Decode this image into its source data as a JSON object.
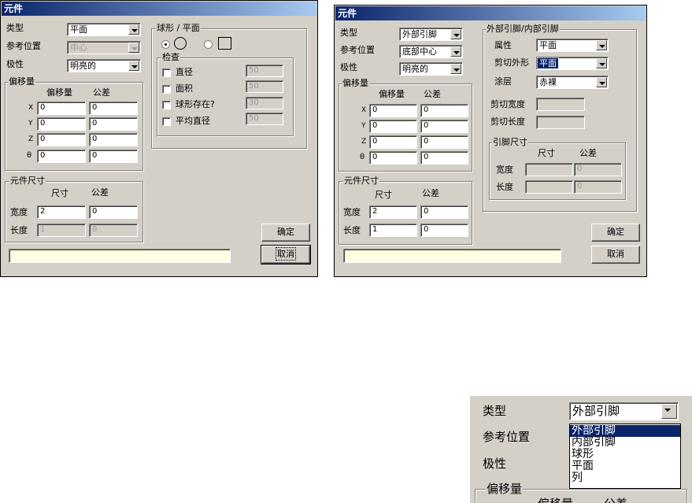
{
  "left_dialog": {
    "title": "元件",
    "type_label": "类型",
    "type_value": "平面",
    "ref_label": "参考位置",
    "ref_value": "中心",
    "polarity_label": "极性",
    "polarity_value": "明亮的",
    "offset_group": "偏移量",
    "offset_col": "偏移量",
    "tol_col": "公差",
    "rows": [
      {
        "label": "X",
        "offset": "0",
        "tol": "0"
      },
      {
        "label": "Y",
        "offset": "0",
        "tol": "0"
      },
      {
        "label": "Z",
        "offset": "0",
        "tol": "0"
      },
      {
        "label": "θ",
        "offset": "0",
        "tol": "0"
      }
    ],
    "size_group": "元件尺寸",
    "size_col": "尺寸",
    "size_tol_col": "公差",
    "width_label": "宽度",
    "width_value": "2",
    "width_tol": "0",
    "length_label": "长度",
    "length_value": "1",
    "length_tol": "0",
    "ball_group": "球形 / 平面",
    "check_group": "检查",
    "checks": [
      {
        "label": "直径",
        "value": "50"
      },
      {
        "label": "面积",
        "value": "50"
      },
      {
        "label": "球形存在?",
        "value": "30"
      },
      {
        "label": "平均直径",
        "value": "50"
      }
    ],
    "ok": "确定",
    "cancel": "取消",
    "status": ""
  },
  "right_dialog": {
    "title": "元件",
    "type_label": "类型",
    "type_value": "外部引脚",
    "ref_label": "参考位置",
    "ref_value": "底部中心",
    "polarity_label": "极性",
    "polarity_value": "明亮的",
    "offset_group": "偏移量",
    "offset_col": "偏移量",
    "tol_col": "公差",
    "rows": [
      {
        "label": "X",
        "offset": "0",
        "tol": "0"
      },
      {
        "label": "Y",
        "offset": "0",
        "tol": "0"
      },
      {
        "label": "Z",
        "offset": "0",
        "tol": "0"
      },
      {
        "label": "θ",
        "offset": "0",
        "tol": "0"
      }
    ],
    "size_group": "元件尺寸",
    "size_col": "尺寸",
    "size_tol_col": "公差",
    "width_label": "宽度",
    "width_value": "2",
    "width_tol": "0",
    "length_label": "长度",
    "length_value": "1",
    "length_tol": "0",
    "lead_group": "外部引脚/内部引脚",
    "attr_label": "属性",
    "attr_value": "平面",
    "cut_shape_label": "剪切外形",
    "cut_shape_value": "平面",
    "coating_label": "涂层",
    "coating_value": "赤裸",
    "cut_width_label": "剪切宽度",
    "cut_length_label": "剪切长度",
    "pin_group": "引脚尺寸",
    "pin_size_col": "尺寸",
    "pin_tol_col": "公差",
    "pin_width_label": "宽度",
    "pin_width_tol": "0",
    "pin_length_label": "长度",
    "pin_length_tol": "0",
    "ok": "确定",
    "cancel": "取消",
    "status": ""
  },
  "zoom_detail": {
    "type_label": "类型",
    "type_value": "外部引脚",
    "ref_label": "参考位置",
    "polarity_label": "极性",
    "offset_group": "偏移量",
    "offset_col": "偏移量",
    "tol_col": "公差",
    "options": [
      "外部引脚",
      "内部引脚",
      "球形",
      "平面",
      "列"
    ]
  }
}
